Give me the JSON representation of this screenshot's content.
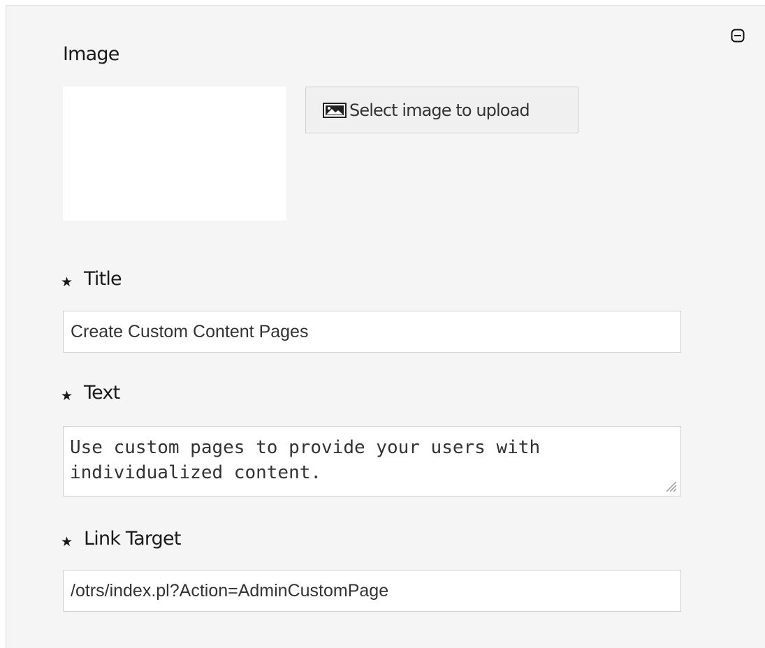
{
  "widget": {
    "collapse_icon": "collapse-minus-icon",
    "image": {
      "label": "Image",
      "upload_button_label": "Select image to upload",
      "upload_icon": "image-icon"
    },
    "title": {
      "label": "Title",
      "required": true,
      "value": "Create Custom Content Pages"
    },
    "text": {
      "label": "Text",
      "required": true,
      "value": "Use custom pages to provide your users with individualized content."
    },
    "link_target": {
      "label": "Link Target",
      "required": true,
      "value": "/otrs/index.pl?Action=AdminCustomPage"
    }
  }
}
